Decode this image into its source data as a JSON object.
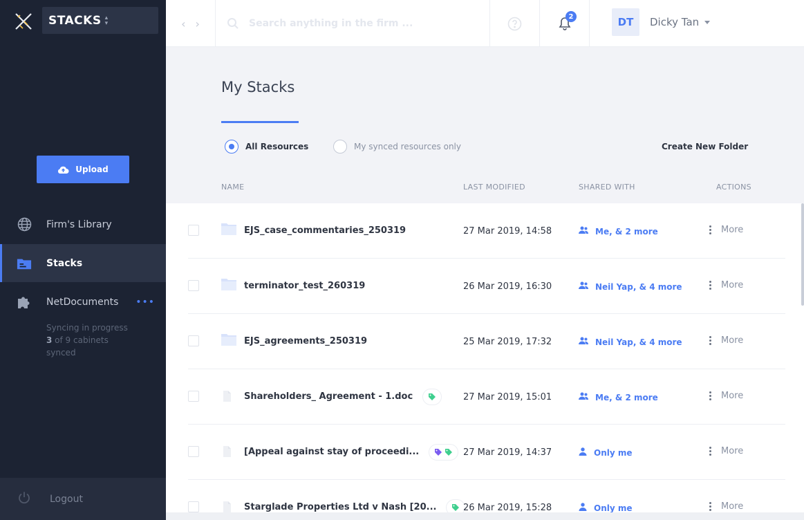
{
  "app": {
    "name": "STACKS"
  },
  "search": {
    "placeholder": "Search anything in the firm ..."
  },
  "notifications": {
    "count": "2"
  },
  "user": {
    "initials": "DT",
    "name": "Dicky Tan"
  },
  "sidebar": {
    "upload_label": "Upload",
    "items": [
      {
        "label": "Firm's Library",
        "icon": "globe-icon"
      },
      {
        "label": "Stacks",
        "icon": "folder-icon",
        "active": true
      },
      {
        "label": "NetDocuments",
        "icon": "puzzle-icon"
      }
    ],
    "sync": {
      "line1": "Syncing in progress",
      "count": "3",
      "line2": " of 9 cabinets",
      "line3": "synced"
    },
    "logout_label": "Logout"
  },
  "main": {
    "title": "My Stacks",
    "filters": [
      "All Resources",
      "My synced resources only"
    ],
    "create_folder_label": "Create New Folder",
    "columns": [
      "NAME",
      "LAST MODIFIED",
      "SHARED WITH",
      "ACTIONS"
    ],
    "more_label": "More",
    "rows": [
      {
        "type": "folder",
        "name": "EJS_case_commentaries_250319",
        "tags": [],
        "modified": "27 Mar 2019, 14:58",
        "shared": "Me,  & 2 more",
        "shared_icon": "group-icon"
      },
      {
        "type": "folder",
        "name": "terminator_test_260319",
        "tags": [],
        "modified": "26 Mar 2019, 16:30",
        "shared": "Neil Yap,  & 4 more",
        "shared_icon": "group-icon"
      },
      {
        "type": "folder",
        "name": "EJS_agreements_250319",
        "tags": [],
        "modified": "25 Mar 2019, 17:32",
        "shared": "Neil Yap,  & 4 more",
        "shared_icon": "group-icon"
      },
      {
        "type": "file",
        "name": "Shareholders_ Agreement - 1.doc",
        "tags": [
          "green"
        ],
        "modified": "27 Mar 2019, 15:01",
        "shared": "Me,  & 2 more",
        "shared_icon": "group-icon"
      },
      {
        "type": "file",
        "name": "[Appeal against stay of proceedi...",
        "tags": [
          "purple",
          "green"
        ],
        "modified": "27 Mar 2019, 14:37",
        "shared": "Only me",
        "shared_icon": "person-icon"
      },
      {
        "type": "file",
        "name": "Starglade Properties Ltd v Nash [20...",
        "tags": [
          "green"
        ],
        "modified": "26 Mar 2019, 15:28",
        "shared": "Only me",
        "shared_icon": "person-icon"
      }
    ]
  },
  "colors": {
    "accent": "#4b7cf3",
    "sidebar_bg": "#1c2333",
    "tag_green": "#3ecf8e",
    "tag_purple": "#7b5cf0"
  }
}
